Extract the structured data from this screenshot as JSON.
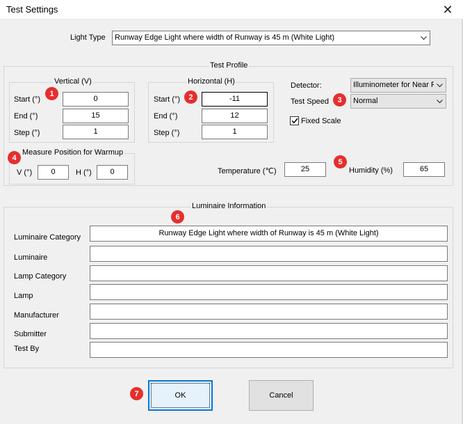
{
  "window": {
    "title": "Test Settings"
  },
  "light_type": {
    "label": "Light Type",
    "value": "Runway Edge Light where width of Runway is 45 m (White Light)"
  },
  "test_profile": {
    "title": "Test Profile",
    "vertical": {
      "title": "Vertical (V)",
      "start_label": "Start (°)",
      "start": "0",
      "end_label": "End (°)",
      "end": "15",
      "step_label": "Step (°)",
      "step": "1"
    },
    "horizontal": {
      "title": "Horizontal (H)",
      "start_label": "Start (°)",
      "start": "-11",
      "end_label": "End (°)",
      "end": "12",
      "step_label": "Step (°)",
      "step": "1"
    },
    "detector_label": "Detector:",
    "detector_value": "Illuminometer for Near F",
    "test_speed_label": "Test Speed",
    "test_speed_value": "Normal",
    "fixed_scale_label": "Fixed Scale",
    "fixed_scale_checked": true,
    "warmup": {
      "title": "Measure Position for Warmup",
      "v_label": "V (°)",
      "v": "0",
      "h_label": "H (°)",
      "h": "0"
    },
    "temperature_label": "Temperature (℃)",
    "temperature": "25",
    "humidity_label": "Humidity (%)",
    "humidity": "65"
  },
  "luminaire_info": {
    "title": "Luminaire Information",
    "category_label": "Luminaire Category",
    "category": "Runway Edge Light where width of Runway is 45 m (White Light)",
    "luminaire_label": "Luminaire",
    "luminaire": "",
    "lamp_category_label": "Lamp Category",
    "lamp_category": "",
    "lamp_label": "Lamp",
    "lamp": "",
    "manufacturer_label": "Manufacturer",
    "manufacturer": "",
    "submitter_label": "Submitter",
    "submitter": "",
    "test_by_label": "Test By",
    "test_by": ""
  },
  "buttons": {
    "ok": "OK",
    "cancel": "Cancel"
  },
  "badges": [
    "1",
    "2",
    "3",
    "4",
    "5",
    "6",
    "7"
  ],
  "colors": {
    "badge": "#e62e2e",
    "default_button_border": "#0078d7"
  }
}
